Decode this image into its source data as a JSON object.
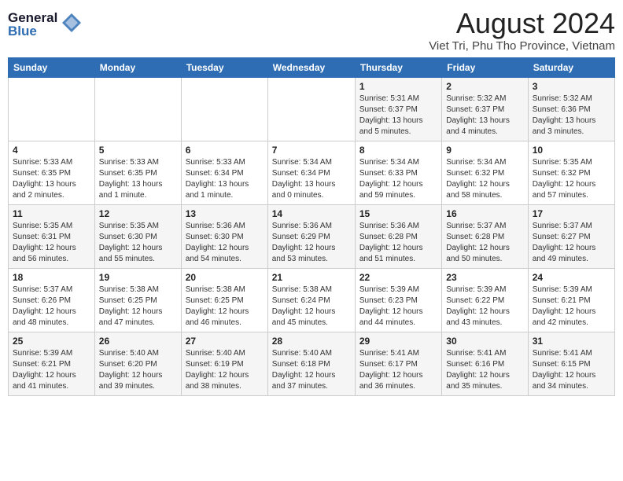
{
  "header": {
    "logo_line1": "General",
    "logo_line2": "Blue",
    "main_title": "August 2024",
    "subtitle": "Viet Tri, Phu Tho Province, Vietnam"
  },
  "calendar": {
    "days_of_week": [
      "Sunday",
      "Monday",
      "Tuesday",
      "Wednesday",
      "Thursday",
      "Friday",
      "Saturday"
    ],
    "weeks": [
      [
        {
          "day": "",
          "info": ""
        },
        {
          "day": "",
          "info": ""
        },
        {
          "day": "",
          "info": ""
        },
        {
          "day": "",
          "info": ""
        },
        {
          "day": "1",
          "info": "Sunrise: 5:31 AM\nSunset: 6:37 PM\nDaylight: 13 hours\nand 5 minutes."
        },
        {
          "day": "2",
          "info": "Sunrise: 5:32 AM\nSunset: 6:37 PM\nDaylight: 13 hours\nand 4 minutes."
        },
        {
          "day": "3",
          "info": "Sunrise: 5:32 AM\nSunset: 6:36 PM\nDaylight: 13 hours\nand 3 minutes."
        }
      ],
      [
        {
          "day": "4",
          "info": "Sunrise: 5:33 AM\nSunset: 6:35 PM\nDaylight: 13 hours\nand 2 minutes."
        },
        {
          "day": "5",
          "info": "Sunrise: 5:33 AM\nSunset: 6:35 PM\nDaylight: 13 hours\nand 1 minute."
        },
        {
          "day": "6",
          "info": "Sunrise: 5:33 AM\nSunset: 6:34 PM\nDaylight: 13 hours\nand 1 minute."
        },
        {
          "day": "7",
          "info": "Sunrise: 5:34 AM\nSunset: 6:34 PM\nDaylight: 13 hours\nand 0 minutes."
        },
        {
          "day": "8",
          "info": "Sunrise: 5:34 AM\nSunset: 6:33 PM\nDaylight: 12 hours\nand 59 minutes."
        },
        {
          "day": "9",
          "info": "Sunrise: 5:34 AM\nSunset: 6:32 PM\nDaylight: 12 hours\nand 58 minutes."
        },
        {
          "day": "10",
          "info": "Sunrise: 5:35 AM\nSunset: 6:32 PM\nDaylight: 12 hours\nand 57 minutes."
        }
      ],
      [
        {
          "day": "11",
          "info": "Sunrise: 5:35 AM\nSunset: 6:31 PM\nDaylight: 12 hours\nand 56 minutes."
        },
        {
          "day": "12",
          "info": "Sunrise: 5:35 AM\nSunset: 6:30 PM\nDaylight: 12 hours\nand 55 minutes."
        },
        {
          "day": "13",
          "info": "Sunrise: 5:36 AM\nSunset: 6:30 PM\nDaylight: 12 hours\nand 54 minutes."
        },
        {
          "day": "14",
          "info": "Sunrise: 5:36 AM\nSunset: 6:29 PM\nDaylight: 12 hours\nand 53 minutes."
        },
        {
          "day": "15",
          "info": "Sunrise: 5:36 AM\nSunset: 6:28 PM\nDaylight: 12 hours\nand 51 minutes."
        },
        {
          "day": "16",
          "info": "Sunrise: 5:37 AM\nSunset: 6:28 PM\nDaylight: 12 hours\nand 50 minutes."
        },
        {
          "day": "17",
          "info": "Sunrise: 5:37 AM\nSunset: 6:27 PM\nDaylight: 12 hours\nand 49 minutes."
        }
      ],
      [
        {
          "day": "18",
          "info": "Sunrise: 5:37 AM\nSunset: 6:26 PM\nDaylight: 12 hours\nand 48 minutes."
        },
        {
          "day": "19",
          "info": "Sunrise: 5:38 AM\nSunset: 6:25 PM\nDaylight: 12 hours\nand 47 minutes."
        },
        {
          "day": "20",
          "info": "Sunrise: 5:38 AM\nSunset: 6:25 PM\nDaylight: 12 hours\nand 46 minutes."
        },
        {
          "day": "21",
          "info": "Sunrise: 5:38 AM\nSunset: 6:24 PM\nDaylight: 12 hours\nand 45 minutes."
        },
        {
          "day": "22",
          "info": "Sunrise: 5:39 AM\nSunset: 6:23 PM\nDaylight: 12 hours\nand 44 minutes."
        },
        {
          "day": "23",
          "info": "Sunrise: 5:39 AM\nSunset: 6:22 PM\nDaylight: 12 hours\nand 43 minutes."
        },
        {
          "day": "24",
          "info": "Sunrise: 5:39 AM\nSunset: 6:21 PM\nDaylight: 12 hours\nand 42 minutes."
        }
      ],
      [
        {
          "day": "25",
          "info": "Sunrise: 5:39 AM\nSunset: 6:21 PM\nDaylight: 12 hours\nand 41 minutes."
        },
        {
          "day": "26",
          "info": "Sunrise: 5:40 AM\nSunset: 6:20 PM\nDaylight: 12 hours\nand 39 minutes."
        },
        {
          "day": "27",
          "info": "Sunrise: 5:40 AM\nSunset: 6:19 PM\nDaylight: 12 hours\nand 38 minutes."
        },
        {
          "day": "28",
          "info": "Sunrise: 5:40 AM\nSunset: 6:18 PM\nDaylight: 12 hours\nand 37 minutes."
        },
        {
          "day": "29",
          "info": "Sunrise: 5:41 AM\nSunset: 6:17 PM\nDaylight: 12 hours\nand 36 minutes."
        },
        {
          "day": "30",
          "info": "Sunrise: 5:41 AM\nSunset: 6:16 PM\nDaylight: 12 hours\nand 35 minutes."
        },
        {
          "day": "31",
          "info": "Sunrise: 5:41 AM\nSunset: 6:15 PM\nDaylight: 12 hours\nand 34 minutes."
        }
      ]
    ]
  }
}
